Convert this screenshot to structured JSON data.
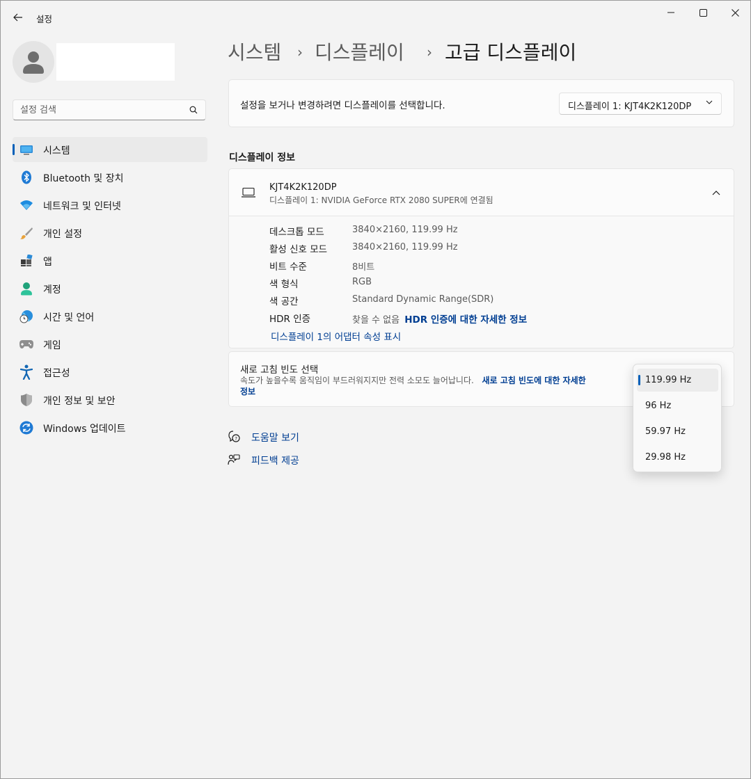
{
  "app": {
    "title": "설정"
  },
  "search": {
    "placeholder": "설정 검색"
  },
  "nav": [
    {
      "label": "시스템",
      "icon": "system-icon",
      "active": true
    },
    {
      "label": "Bluetooth 및 장치",
      "icon": "bluetooth-icon"
    },
    {
      "label": "네트워크 및 인터넷",
      "icon": "wifi-icon"
    },
    {
      "label": "개인 설정",
      "icon": "brush-icon"
    },
    {
      "label": "앱",
      "icon": "apps-icon"
    },
    {
      "label": "계정",
      "icon": "account-icon"
    },
    {
      "label": "시간 및 언어",
      "icon": "time-language-icon"
    },
    {
      "label": "게임",
      "icon": "gamepad-icon"
    },
    {
      "label": "접근성",
      "icon": "accessibility-icon"
    },
    {
      "label": "개인 정보 및 보안",
      "icon": "shield-icon"
    },
    {
      "label": "Windows 업데이트",
      "icon": "update-icon"
    }
  ],
  "breadcrumb": {
    "first": "시스템",
    "second": "디스플레이",
    "current": "고급 디스플레이",
    "separator": "›"
  },
  "display_select": {
    "prompt": "설정을 보거나 변경하려면 디스플레이를 선택합니다.",
    "selected": "디스플레이 1: KJT4K2K120DP"
  },
  "display_info": {
    "section_title": "디스플레이 정보",
    "monitor_name": "KJT4K2K120DP",
    "monitor_subtitle": "디스플레이 1: NVIDIA GeForce RTX 2080 SUPER에 연결됨",
    "rows": [
      {
        "label": "데스크톱 모드",
        "value": "3840×2160, 119.99 Hz"
      },
      {
        "label": "활성 신호 모드",
        "value": "3840×2160, 119.99 Hz"
      },
      {
        "label": "비트 수준",
        "value": "8비트"
      },
      {
        "label": "색 형식",
        "value": "RGB"
      },
      {
        "label": "색 공간",
        "value": "Standard Dynamic Range(SDR)"
      },
      {
        "label": "HDR 인증",
        "value": "찾을 수 없음",
        "link": "HDR 인증에 대한 자세한 정보"
      }
    ],
    "adapter_link": "디스플레이 1의 어댑터 속성 표시"
  },
  "refresh_rate": {
    "title": "새로 고침 빈도 선택",
    "desc": "속도가 높을수록 움직임이 부드러워지지만 전력 소모도 늘어납니다.",
    "link_line1": "새로 고침 빈도에 대한 자세한",
    "link_line2": "정보",
    "options": [
      "119.99 Hz",
      "96 Hz",
      "59.97 Hz",
      "29.98 Hz"
    ],
    "selected": "119.99 Hz"
  },
  "help": {
    "get_help": "도움말 보기",
    "feedback": "피드백 제공"
  },
  "colors": {
    "accent": "#005fb8",
    "link": "#003e92",
    "background": "#f3f3f3",
    "card": "#fbfbfb"
  }
}
